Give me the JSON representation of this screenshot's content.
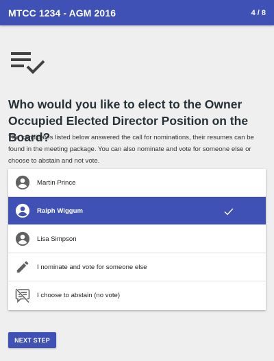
{
  "appbar": {
    "title": "MTCC 1234 - AGM 2016",
    "step": "4 / 8"
  },
  "header_icon": "ballot-list-check-icon",
  "question": "Who would you like to elect to the Owner Occupied Elected Director Position on the Board?",
  "description": "The candidates listed below answered the call for nominations, their resumes can be found in the meeting package. You can also nominate and vote for someone else or choose to abstain and not vote.",
  "options": [
    {
      "label": "Martin Prince",
      "icon": "account-circle-icon",
      "selected": false
    },
    {
      "label": "Ralph Wiggum",
      "icon": "account-circle-icon",
      "selected": true
    },
    {
      "label": "Lisa Simpson",
      "icon": "account-circle-icon",
      "selected": false
    },
    {
      "label": "I nominate and vote for someone else",
      "icon": "pencil-icon",
      "selected": false
    },
    {
      "label": "I choose to abstain (no vote)",
      "icon": "comment-off-icon",
      "selected": false
    }
  ],
  "next_button": "NEXT STEP",
  "colors": {
    "primary": "#3f51b5",
    "background": "#efefef",
    "icon_gray": "#616161"
  }
}
